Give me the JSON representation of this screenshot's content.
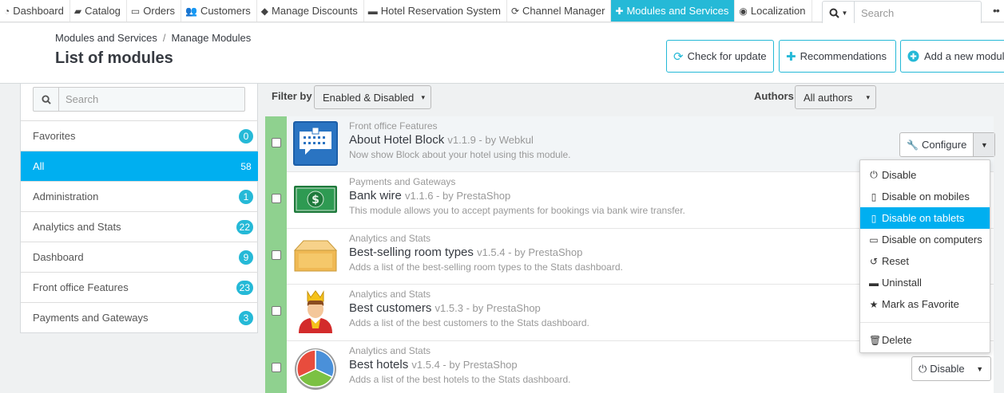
{
  "topnav": {
    "items": [
      {
        "label": "Dashboard",
        "icon": "dashboard-icon",
        "glyph": "◔"
      },
      {
        "label": "Catalog",
        "icon": "book-icon",
        "glyph": "▰"
      },
      {
        "label": "Orders",
        "icon": "credit-card-icon",
        "glyph": "▭"
      },
      {
        "label": "Customers",
        "icon": "users-icon",
        "glyph": "👥"
      },
      {
        "label": "Manage Discounts",
        "icon": "tag-icon",
        "glyph": "◆"
      },
      {
        "label": "Hotel Reservation System",
        "icon": "bed-icon",
        "glyph": "▬"
      },
      {
        "label": "Channel Manager",
        "icon": "refresh-icon",
        "glyph": "⟳"
      },
      {
        "label": "Modules and Services",
        "icon": "puzzle-icon",
        "glyph": "✚",
        "active": true
      },
      {
        "label": "Localization",
        "icon": "globe-icon",
        "glyph": "◉"
      }
    ],
    "search_placeholder": "Search"
  },
  "header": {
    "breadcrumb": [
      "Modules and Services",
      "Manage Modules"
    ],
    "breadcrumb_sep": "/",
    "title": "List of modules",
    "buttons": {
      "check_update": "Check for update",
      "recommendations": "Recommendations",
      "add_module": "Add a new module"
    }
  },
  "sidebar": {
    "search_placeholder": "Search",
    "categories": [
      {
        "label": "Favorites",
        "count": "0"
      },
      {
        "label": "All",
        "count": "58",
        "active": true
      },
      {
        "label": "Administration",
        "count": "1"
      },
      {
        "label": "Analytics and Stats",
        "count": "22"
      },
      {
        "label": "Dashboard",
        "count": "9"
      },
      {
        "label": "Front office Features",
        "count": "23"
      },
      {
        "label": "Payments and Gateways",
        "count": "3"
      }
    ]
  },
  "filters": {
    "filter_label": "Filter by",
    "filter_value": "Enabled & Disabled",
    "authors_label": "Authors",
    "authors_value": "All authors"
  },
  "modules": [
    {
      "category": "Front office Features",
      "name": "About Hotel Block",
      "version": "v1.1.9 - by Webkul",
      "description": "Now show Block about your hotel using this module.",
      "icon": "hotel-block-icon"
    },
    {
      "category": "Payments and Gateways",
      "name": "Bank wire",
      "version": "v1.1.6 - by PrestaShop",
      "description": "This module allows you to accept payments for bookings via bank wire transfer.",
      "icon": "banknote-icon"
    },
    {
      "category": "Analytics and Stats",
      "name": "Best-selling room types",
      "version": "v1.5.4 - by PrestaShop",
      "description": "Adds a list of the best-selling room types to the Stats dashboard.",
      "icon": "box-icon"
    },
    {
      "category": "Analytics and Stats",
      "name": "Best customers",
      "version": "v1.5.3 - by PrestaShop",
      "description": "Adds a list of the best customers to the Stats dashboard.",
      "icon": "king-icon"
    },
    {
      "category": "Analytics and Stats",
      "name": "Best hotels",
      "version": "v1.5.4 - by PrestaShop",
      "description": "Adds a list of the best hotels to the Stats dashboard.",
      "icon": "pie-chart-icon"
    }
  ],
  "actions": {
    "configure": "Configure",
    "disable": "Disable"
  },
  "dropdown": {
    "items": [
      {
        "label": "Disable",
        "icon": "power-icon",
        "glyph": "⏻"
      },
      {
        "label": "Disable on mobiles",
        "icon": "mobile-icon",
        "glyph": "▯"
      },
      {
        "label": "Disable on tablets",
        "icon": "tablet-icon",
        "glyph": "▯",
        "highlighted": true
      },
      {
        "label": "Disable on computers",
        "icon": "desktop-icon",
        "glyph": "▭"
      },
      {
        "label": "Reset",
        "icon": "undo-icon",
        "glyph": "↺"
      },
      {
        "label": "Uninstall",
        "icon": "minus-square-icon",
        "glyph": "▬"
      },
      {
        "label": "Mark as Favorite",
        "icon": "star-icon",
        "glyph": "★"
      }
    ],
    "delete": {
      "label": "Delete",
      "icon": "trash-icon",
      "glyph": "🗑"
    }
  },
  "colors": {
    "accent": "#25b9d7",
    "active_bg": "#00aff0",
    "enabled_bar": "#8fd18f"
  }
}
